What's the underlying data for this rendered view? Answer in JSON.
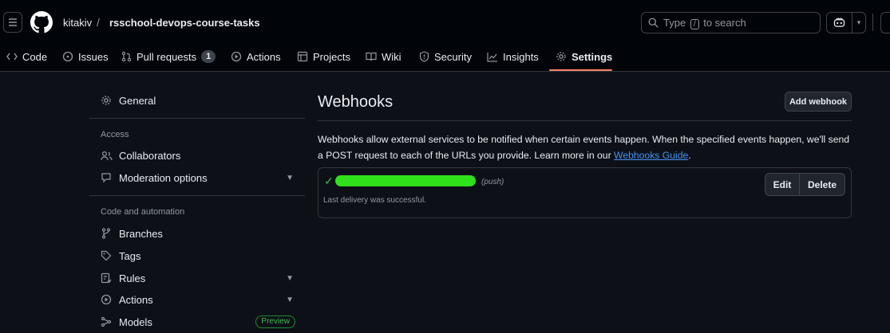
{
  "header": {
    "owner": "kitakiv",
    "separator": "/",
    "repo": "rsschool-devops-course-tasks",
    "search": {
      "prefix": "Type",
      "key": "/",
      "suffix": "to search"
    }
  },
  "tabs": [
    {
      "label": "Code",
      "icon": "code-icon"
    },
    {
      "label": "Issues",
      "icon": "issue-icon"
    },
    {
      "label": "Pull requests",
      "icon": "pull-request-icon",
      "count": "1"
    },
    {
      "label": "Actions",
      "icon": "play-icon"
    },
    {
      "label": "Projects",
      "icon": "table-icon"
    },
    {
      "label": "Wiki",
      "icon": "book-icon"
    },
    {
      "label": "Security",
      "icon": "shield-icon"
    },
    {
      "label": "Insights",
      "icon": "graph-icon"
    },
    {
      "label": "Settings",
      "icon": "gear-icon",
      "active": true
    }
  ],
  "sidebar": {
    "general": "General",
    "access_heading": "Access",
    "collaborators": "Collaborators",
    "moderation": "Moderation options",
    "code_heading": "Code and automation",
    "branches": "Branches",
    "tags": "Tags",
    "rules": "Rules",
    "actions": "Actions",
    "models": "Models",
    "models_badge": "Preview"
  },
  "main": {
    "title": "Webhooks",
    "add_button": "Add webhook",
    "desc_text": "Webhooks allow external services to be notified when certain events happen. When the specified events happen, we'll send a POST request to each of the URLs you provide. Learn more in our ",
    "desc_link": "Webhooks Guide",
    "desc_end": ".",
    "webhook": {
      "events": "(push)",
      "status": "Last delivery was successful.",
      "edit": "Edit",
      "delete": "Delete"
    }
  },
  "colors": {
    "background": "#0d1117",
    "header": "#010409",
    "accent_underline": "#f78166",
    "link": "#4493f8",
    "success": "#3fb950"
  }
}
